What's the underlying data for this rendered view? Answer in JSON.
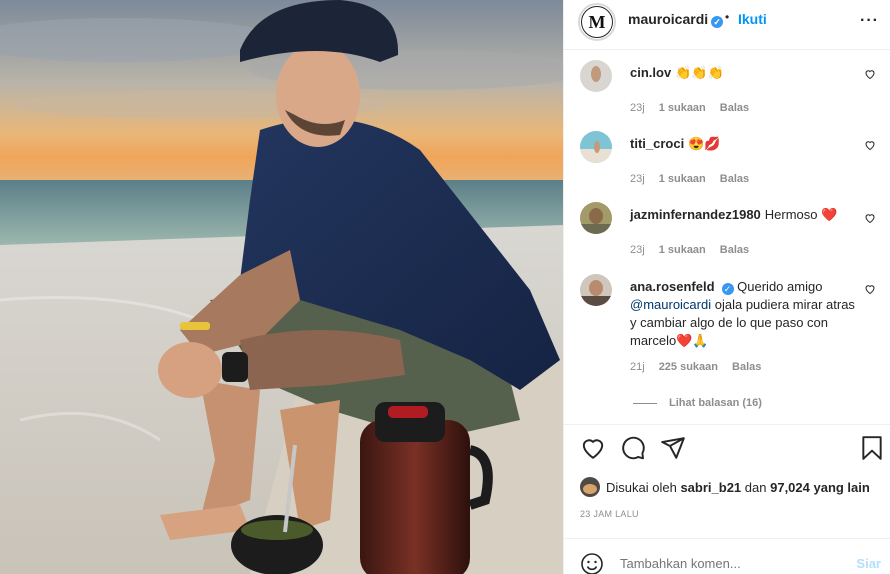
{
  "post": {
    "username": "mauroicardi",
    "dot": "•",
    "follow_label": "Ikuti",
    "more_label": "···",
    "avatar_letters": "M"
  },
  "comments": [
    {
      "user": "cin.lov",
      "text": "👏👏👏",
      "time": "23j",
      "likes": "1 sukaan",
      "reply": "Balas"
    },
    {
      "user": "titi_croci",
      "text": "😍💋",
      "time": "23j",
      "likes": "1 sukaan",
      "reply": "Balas"
    },
    {
      "user": "jazminfernandez1980",
      "text": "Hermoso ❤️",
      "time": "23j",
      "likes": "1 sukaan",
      "reply": "Balas"
    },
    {
      "user": "ana.rosenfeld",
      "mention": "@mauroicardi",
      "text_before": "Querido amigo",
      "text_after": "ojala pudiera mirar atras y cambiar algo de lo que paso con marcelo❤️🙏",
      "time": "21j",
      "likes": "225 sukaan",
      "reply": "Balas"
    }
  ],
  "view_replies": "Lihat balasan (16)",
  "likes_line": {
    "prefix": "Disukai oleh",
    "user": "sabri_b21",
    "mid": "dan",
    "count": "97,024 yang lain"
  },
  "timestamp": "23 JAM LALU",
  "add_comment": {
    "placeholder": "Tambahkan komen...",
    "post_label": "Siar"
  },
  "colors": {
    "accent": "#0095f6",
    "verified": "#3897f0",
    "muted": "#8e8e8e"
  },
  "icons": [
    "heart-icon",
    "comment-icon",
    "share-icon",
    "bookmark-icon",
    "smile-icon",
    "verified-icon",
    "more-icon"
  ]
}
